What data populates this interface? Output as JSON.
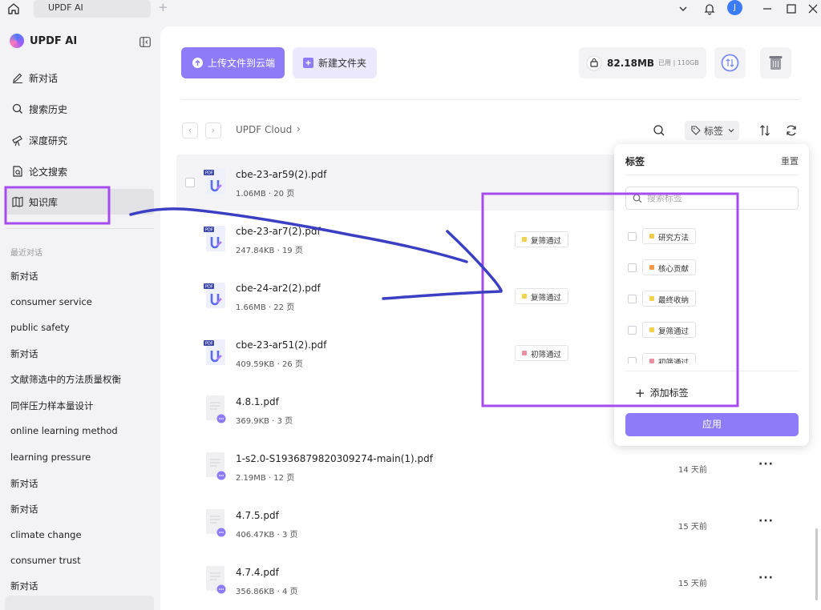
{
  "titlebar": {
    "tab_label": "UPDF AI",
    "avatar_initial": "J"
  },
  "sidebar": {
    "brand": "UPDF AI",
    "nav": [
      {
        "label": "新对话"
      },
      {
        "label": "搜索历史"
      },
      {
        "label": "深度研究"
      },
      {
        "label": "论文搜索"
      },
      {
        "label": "知识库"
      }
    ],
    "recent_title": "最近对话",
    "recent": [
      "新对话",
      "consumer service",
      "public safety",
      "新对话",
      "文献筛选中的方法质量权衡",
      "同伴压力样本量设计",
      "online learning method",
      "learning pressure",
      "新对话",
      "新对话",
      "climate change",
      "consumer trust",
      "新对话"
    ]
  },
  "toolbar": {
    "upload_label": "上传文件到云端",
    "new_folder_label": "新建文件夹",
    "storage_used": "82.18MB",
    "storage_total": "已用 | 110GB"
  },
  "breadcrumb": {
    "root": "UPDF Cloud"
  },
  "filter": {
    "tag_label": "标签"
  },
  "files": [
    {
      "name": "cbe-23-ar59(2).pdf",
      "meta": "1.06MB · 20 页",
      "type": "pdf",
      "tag": "",
      "date": ""
    },
    {
      "name": "cbe-23-ar7(2).pdf",
      "meta": "247.84KB · 19 页",
      "type": "pdf",
      "tag": "复筛通过",
      "date": ""
    },
    {
      "name": "cbe-24-ar2(2).pdf",
      "meta": "1.66MB · 22 页",
      "type": "pdf",
      "tag": "复筛通过",
      "date": ""
    },
    {
      "name": "cbe-23-ar51(2).pdf",
      "meta": "409.59KB · 26 页",
      "type": "pdf",
      "tag": "初筛通过",
      "date": ""
    },
    {
      "name": "4.8.1.pdf",
      "meta": "369.9KB · 3 页",
      "type": "doc",
      "tag": "",
      "date": ""
    },
    {
      "name": "1-s2.0-S1936879820309274-main(1).pdf",
      "meta": "2.19MB · 12 页",
      "type": "doc",
      "tag": "",
      "date": "14 天前"
    },
    {
      "name": "4.7.5.pdf",
      "meta": "406.47KB · 3 页",
      "type": "doc",
      "tag": "",
      "date": "15 天前"
    },
    {
      "name": "4.7.4.pdf",
      "meta": "356.86KB · 4 页",
      "type": "doc",
      "tag": "",
      "date": "15 天前"
    }
  ],
  "tag_popup": {
    "title": "标签",
    "reset_label": "重置",
    "search_placeholder": "搜索标签",
    "options": [
      {
        "label": "研究方法",
        "color": "#f2c94c"
      },
      {
        "label": "核心贡献",
        "color": "#f2994a"
      },
      {
        "label": "最终收纳",
        "color": "#f2d14c"
      },
      {
        "label": "复筛通过",
        "color": "#f2d14c"
      },
      {
        "label": "初筛通过",
        "color": "#eb8fa0"
      }
    ],
    "add_label": "添加标签",
    "apply_label": "应用"
  },
  "tag_colors": {
    "复筛通过": "#f2d14c",
    "初筛通过": "#eb8fa0"
  },
  "accent_color": "#8e7bf7",
  "annotation_color": "#a64bf0"
}
